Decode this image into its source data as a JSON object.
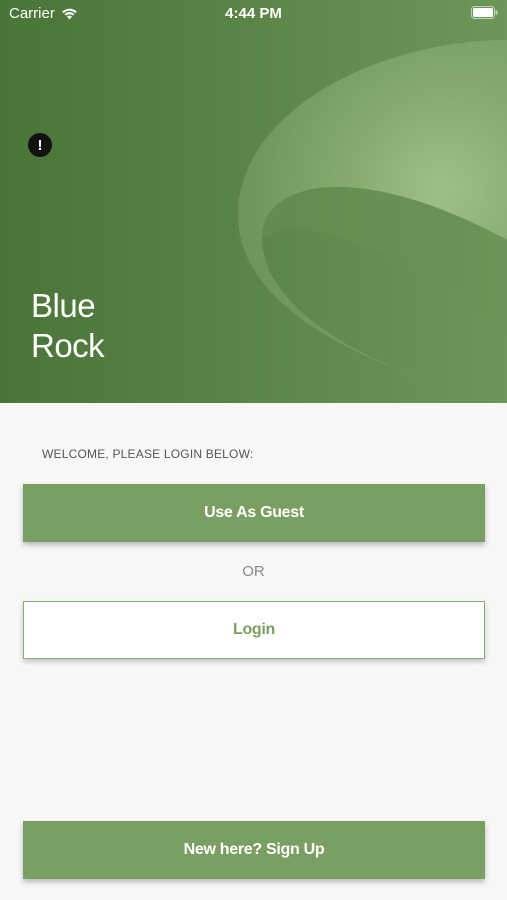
{
  "status_bar": {
    "carrier": "Carrier",
    "time": "4:44 PM",
    "icons": [
      "wifi-icon",
      "battery-icon"
    ]
  },
  "hero": {
    "title_line1": "Blue",
    "title_line2": "Rock",
    "alert_icon": "exclamation-circle-icon",
    "alert_glyph": "!"
  },
  "login": {
    "welcome_text": "WELCOME, PLEASE LOGIN BELOW:",
    "guest_label": "Use As Guest",
    "or_text": "OR",
    "login_label": "Login",
    "signup_label": "New here? Sign Up"
  },
  "colors": {
    "brand_green": "#7a9f63",
    "hero_green": "#5a8446",
    "background": "#f7f7f7"
  }
}
